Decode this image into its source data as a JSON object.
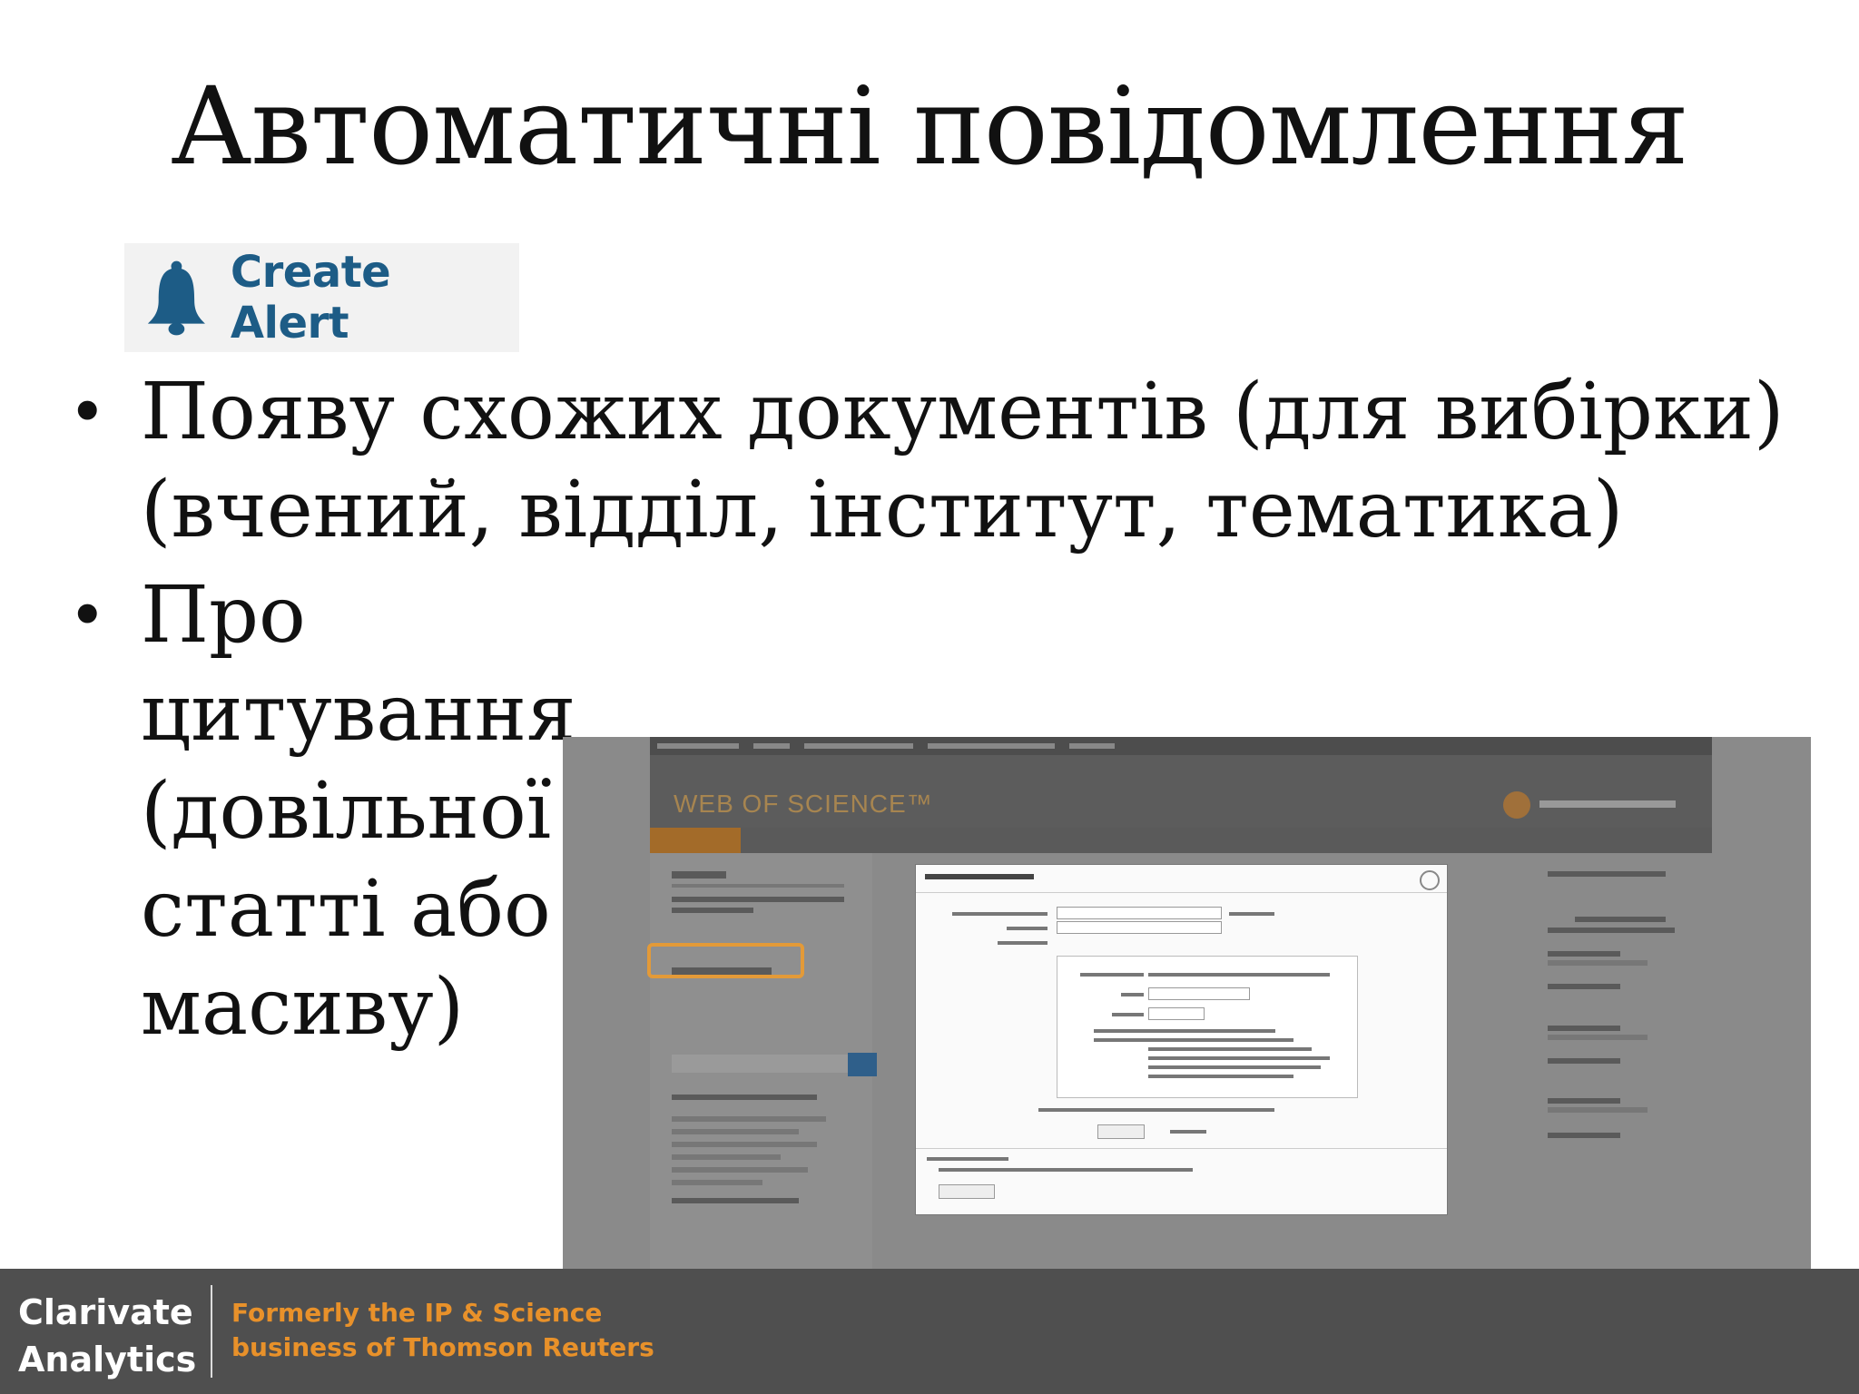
{
  "slide": {
    "title": "Автоматичні повідомлення"
  },
  "alert_button": {
    "label": "Create Alert",
    "icon": "bell-icon",
    "color": "#1d5c86"
  },
  "bullets": [
    "Появу схожих документів (для вибірки) (вчений, відділ, інститут, тематика)",
    "Про цитування (довільної статті або масиву)"
  ],
  "screenshot": {
    "product": "WEB OF SCIENCE™"
  },
  "footer": {
    "brand_line1": "Clarivate",
    "brand_line2": "Analytics",
    "tagline_line1": "Formerly the IP & Science",
    "tagline_line2": "business of Thomson Reuters",
    "accent": "#e8912a"
  }
}
